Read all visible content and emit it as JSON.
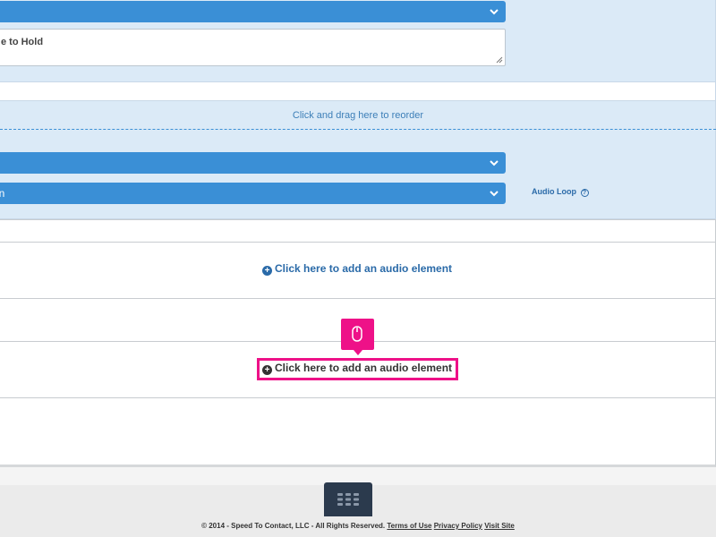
{
  "element_panel": {
    "greeting_value": "e to Hold",
    "drag_hint": "Click and drag here to reorder",
    "second_select_value": "in",
    "audio_loop_label": "Audio Loop",
    "audio_loop_help": "?"
  },
  "audio_elements": {
    "add_label_1": "Click here to add an audio element",
    "add_label_2": "Click here to add an audio element",
    "plus_glyph": "+"
  },
  "footer": {
    "copyright": "© 2014 - Speed To Contact, LLC - All Rights Reserved.",
    "terms_link": "Terms of Use",
    "privacy_link": "Privacy Policy",
    "visit_link": "Visit Site"
  },
  "colors": {
    "accent_blue": "#3a8fd6",
    "panel_bg": "#dbeaf7",
    "highlight": "#ee1188",
    "footer_tab": "#2b3a4d"
  },
  "icons": {
    "select_chevron": "chevron-down-icon",
    "add_element": "plus-circle-icon",
    "help": "question-circle-icon",
    "cursor_hint": "mouse-icon",
    "apps_menu": "grid-icon"
  }
}
